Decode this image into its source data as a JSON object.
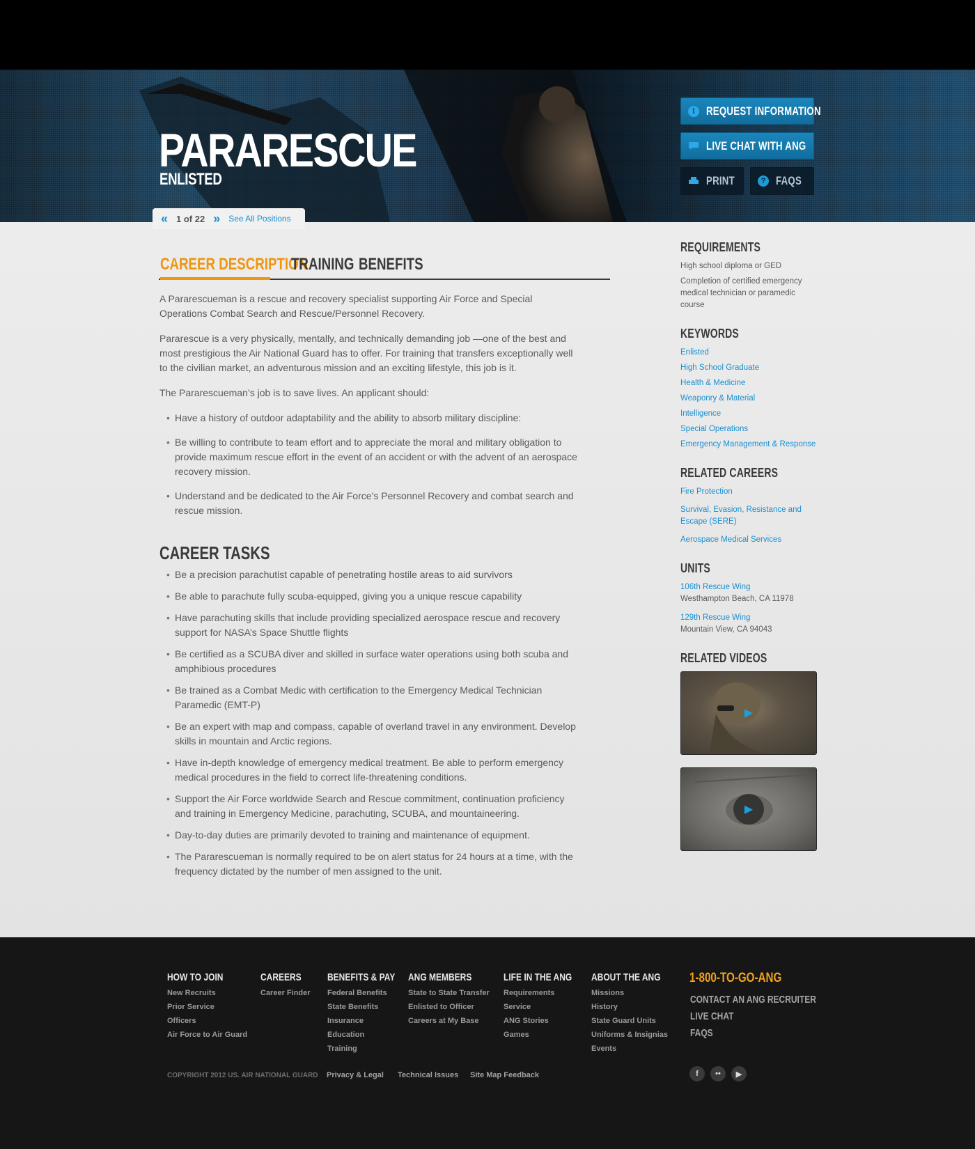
{
  "hero": {
    "title": "PARARESCUE",
    "subtitle": "ENLISTED",
    "buttons": {
      "request": "REQUEST INFORMATION",
      "chat": "LIVE CHAT WITH ANG",
      "print": "PRINT",
      "faqs": "FAQS"
    },
    "pager": {
      "count": "1 of 22",
      "see_all": "See All Positions"
    }
  },
  "tabs": [
    "CAREER DESCRIPTION",
    "TRAINING",
    "BENEFITS"
  ],
  "description": {
    "p1": "A Pararescueman is a rescue and recovery specialist supporting Air Force and Special Operations Combat Search and Rescue/Personnel Recovery.",
    "p2": "Pararescue is a very physically, mentally, and technically demanding job —one of the best and most prestigious the Air National Guard has to offer. For training that transfers exceptionally well to the civilian market, an adventurous mission and an exciting lifestyle, this job is it.",
    "p3": "The Pararescueman’s job is to save lives. An applicant should:",
    "bullets": [
      "Have a history of outdoor adaptability and the ability to absorb military discipline:",
      "Be willing to contribute to team effort and to appreciate the moral and military obligation to provide maximum rescue effort in the event of an accident or with the advent of an aerospace recovery mission.",
      "Understand and be dedicated to the Air Force’s Personnel Recovery and combat search and rescue mission."
    ]
  },
  "tasks": {
    "heading": "CAREER TASKS",
    "items": [
      "Be a precision parachutist capable of penetrating hostile areas to aid survivors",
      "Be able to parachute fully scuba-equipped, giving you a unique rescue capability",
      "Have parachuting skills that include providing specialized aerospace rescue and recovery support for NASA’s Space Shuttle flights",
      "Be certified as a SCUBA diver and skilled in surface water operations using both scuba and amphibious procedures",
      "Be trained as a Combat Medic with certification to the Emergency Medical Technician Paramedic (EMT-P)",
      "Be an expert with map and compass, capable of overland travel in any environment. Develop skills in mountain and Arctic regions.",
      "Have in-depth knowledge of emergency medical treatment. Be able to perform emergency medical procedures in the field to correct life-threatening conditions.",
      "Support the Air Force worldwide Search and Rescue commitment, continuation proficiency and training in Emergency Medicine, parachuting, SCUBA, and mountaineering.",
      "Day-to-day duties are primarily devoted to training and maintenance of equipment.",
      "The Pararescueman is normally required to be on alert status for 24 hours at a time, with the frequency dictated by the number of men assigned to the unit."
    ]
  },
  "sidebar": {
    "requirements": {
      "heading": "REQUIREMENTS",
      "items": [
        "High school diploma or GED",
        "Completion of certified emergency medical technician or paramedic course"
      ]
    },
    "keywords": {
      "heading": "KEYWORDS",
      "items": [
        "Enlisted",
        "High School Graduate",
        "Health & Medicine",
        "Weaponry & Material",
        "Intelligence",
        "Special Operations",
        "Emergency Management & Response"
      ]
    },
    "related": {
      "heading": "RELATED CAREERS",
      "items": [
        "Fire Protection",
        "Survival, Evasion, Resistance and Escape  (SERE)",
        "Aerospace Medical Services"
      ]
    },
    "units": {
      "heading": "UNITS",
      "items": [
        {
          "name": "106th Rescue Wing",
          "location": "Westhampton Beach, CA 11978"
        },
        {
          "name": "129th Rescue Wing",
          "location": "Mountain View, CA 94043"
        }
      ]
    },
    "videos": {
      "heading": "RELATED VIDEOS"
    }
  },
  "footer": {
    "cols": [
      {
        "heading": "HOW TO JOIN",
        "links": [
          "New Recruits",
          "Prior Service",
          "Officers",
          "Air Force to Air Guard"
        ]
      },
      {
        "heading": "CAREERS",
        "links": [
          "Career Finder"
        ]
      },
      {
        "heading": "BENEFITS & PAY",
        "links": [
          "Federal Benefits",
          "State Benefits",
          "Insurance",
          "Education",
          "Training"
        ]
      },
      {
        "heading": "ANG MEMBERS",
        "links": [
          "State to State Transfer",
          "Enlisted to Officer",
          "Careers at My Base"
        ]
      },
      {
        "heading": "LIFE IN THE ANG",
        "links": [
          "Requirements",
          "Service",
          "ANG Stories",
          "Games"
        ]
      },
      {
        "heading": "ABOUT THE ANG",
        "links": [
          "Missions",
          "History",
          "State Guard Units",
          "Uniforms & Insignias",
          "Events"
        ]
      }
    ],
    "phone": "1-800-TO-GO-ANG",
    "contact": "CONTACT AN ANG RECRUITER",
    "live_chat": "LIVE CHAT",
    "faqs": "FAQS",
    "copyright": "COPYRIGHT 2012 US. AIR NATIONAL GUARD",
    "legal": [
      "Privacy & Legal",
      "Technical Issues",
      "Site Map Feedback"
    ],
    "social": [
      "f",
      "••",
      "▶"
    ]
  },
  "colors": {
    "accent_orange": "#f0960e",
    "link_blue": "#1a8fd0",
    "footer_bg": "#161616"
  }
}
